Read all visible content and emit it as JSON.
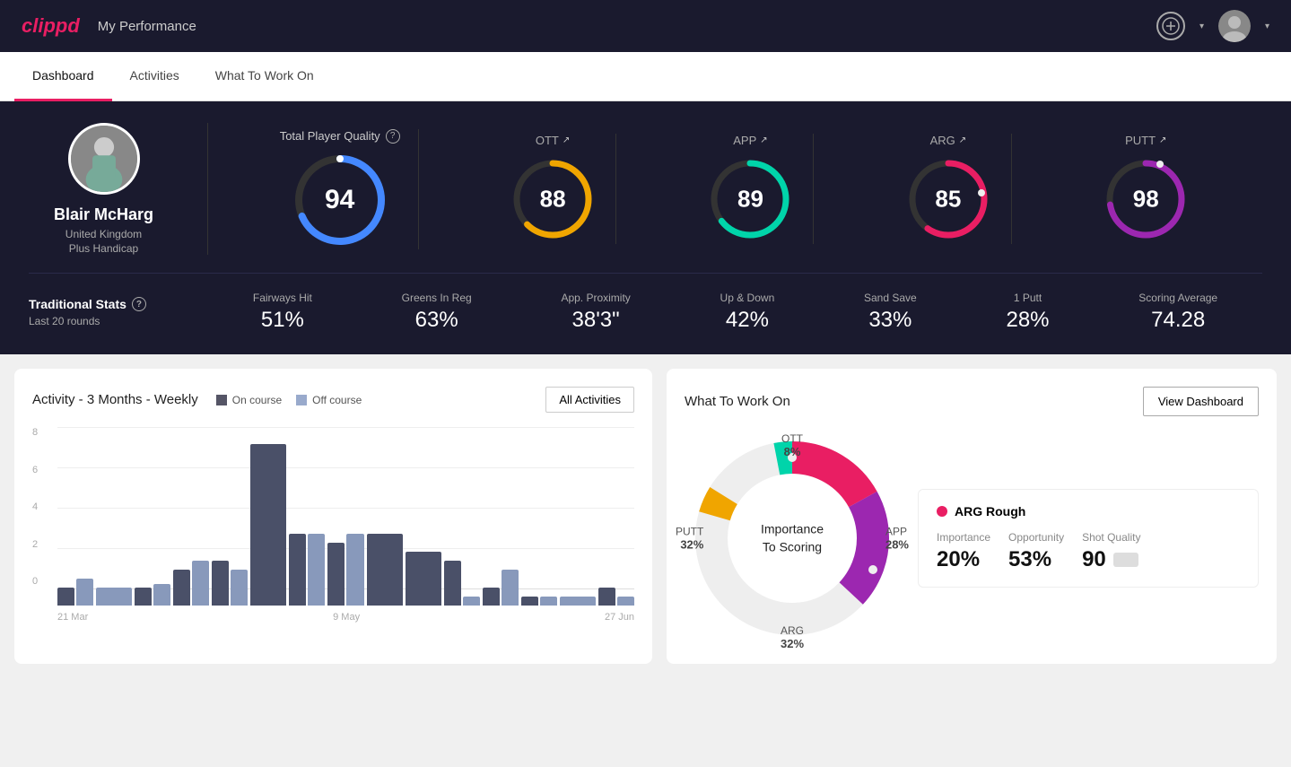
{
  "header": {
    "logo": "clippd",
    "title": "My Performance",
    "add_button_label": "+"
  },
  "nav": {
    "tabs": [
      {
        "label": "Dashboard",
        "active": true
      },
      {
        "label": "Activities",
        "active": false
      },
      {
        "label": "What To Work On",
        "active": false
      }
    ]
  },
  "player": {
    "name": "Blair McHarg",
    "country": "United Kingdom",
    "handicap": "Plus Handicap"
  },
  "scores": {
    "tpq_label": "Total Player Quality",
    "total": {
      "value": "94",
      "color_start": "#4488ff",
      "color_end": "#4488ff"
    },
    "ott": {
      "label": "OTT",
      "value": "88",
      "color": "#f0a500"
    },
    "app": {
      "label": "APP",
      "value": "89",
      "color": "#00d4aa"
    },
    "arg": {
      "label": "ARG",
      "value": "85",
      "color": "#e91e63"
    },
    "putt": {
      "label": "PUTT",
      "value": "98",
      "color": "#9c27b0"
    }
  },
  "traditional_stats": {
    "label": "Traditional Stats",
    "sublabel": "Last 20 rounds",
    "stats": [
      {
        "label": "Fairways Hit",
        "value": "51%"
      },
      {
        "label": "Greens In Reg",
        "value": "63%"
      },
      {
        "label": "App. Proximity",
        "value": "38'3\""
      },
      {
        "label": "Up & Down",
        "value": "42%"
      },
      {
        "label": "Sand Save",
        "value": "33%"
      },
      {
        "label": "1 Putt",
        "value": "28%"
      },
      {
        "label": "Scoring Average",
        "value": "74.28"
      }
    ]
  },
  "activity_chart": {
    "title": "Activity - 3 Months - Weekly",
    "legend": {
      "on_course": "On course",
      "off_course": "Off course"
    },
    "all_activities_btn": "All Activities",
    "x_labels": [
      "21 Mar",
      "9 May",
      "27 Jun"
    ],
    "y_labels": [
      "8",
      "6",
      "4",
      "2",
      "0"
    ],
    "bars": [
      {
        "on": 1,
        "off": 1.5
      },
      {
        "on": 0,
        "off": 1
      },
      {
        "on": 1,
        "off": 1.2
      },
      {
        "on": 2,
        "off": 2.5
      },
      {
        "on": 2.5,
        "off": 2
      },
      {
        "on": 9,
        "off": 0
      },
      {
        "on": 4,
        "off": 4
      },
      {
        "on": 3.5,
        "off": 4
      },
      {
        "on": 4,
        "off": 0
      },
      {
        "on": 3,
        "off": 0
      },
      {
        "on": 2.5,
        "off": 0.5
      },
      {
        "on": 1,
        "off": 2
      },
      {
        "on": 0.5,
        "off": 0.5
      },
      {
        "on": 0,
        "off": 0.5
      },
      {
        "on": 1,
        "off": 0.5
      }
    ]
  },
  "what_to_work_on": {
    "title": "What To Work On",
    "view_dashboard_btn": "View Dashboard",
    "donut_center": "Importance\nTo Scoring",
    "segments": [
      {
        "label": "OTT",
        "pct": "8%",
        "color": "#f0a500",
        "angle": 15
      },
      {
        "label": "APP",
        "pct": "28%",
        "color": "#00d4aa",
        "angle": 110
      },
      {
        "label": "ARG",
        "pct": "32%",
        "color": "#e91e63",
        "angle": 220
      },
      {
        "label": "PUTT",
        "pct": "32%",
        "color": "#9c27b0",
        "angle": 310
      }
    ],
    "arg_card": {
      "title": "ARG Rough",
      "stats": [
        {
          "label": "Importance",
          "value": "20%"
        },
        {
          "label": "Opportunity",
          "value": "53%"
        },
        {
          "label": "Shot Quality",
          "value": "90"
        }
      ]
    }
  }
}
